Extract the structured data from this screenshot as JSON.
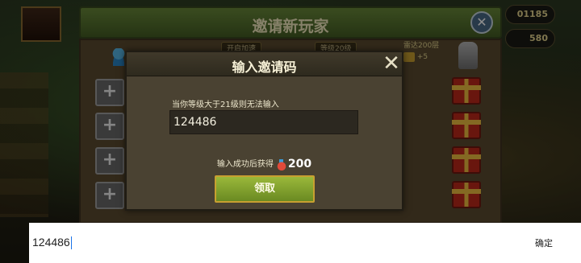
{
  "background": {
    "invite_panel": {
      "title": "邀请新玩家",
      "tabs": [
        "开启加速",
        "等级20级"
      ],
      "reward_header": "雷达200层",
      "reward_bonus": "+5"
    },
    "resources": [
      "01185",
      "580"
    ]
  },
  "dialog": {
    "title": "输入邀请码",
    "hint": "当你等级大于21级则无法输入",
    "code_value": "124486",
    "reward_prefix": "输入成功后获得",
    "reward_amount": "200",
    "claim_label": "领取"
  },
  "ime": {
    "text": "124486",
    "confirm_label": "确定"
  }
}
